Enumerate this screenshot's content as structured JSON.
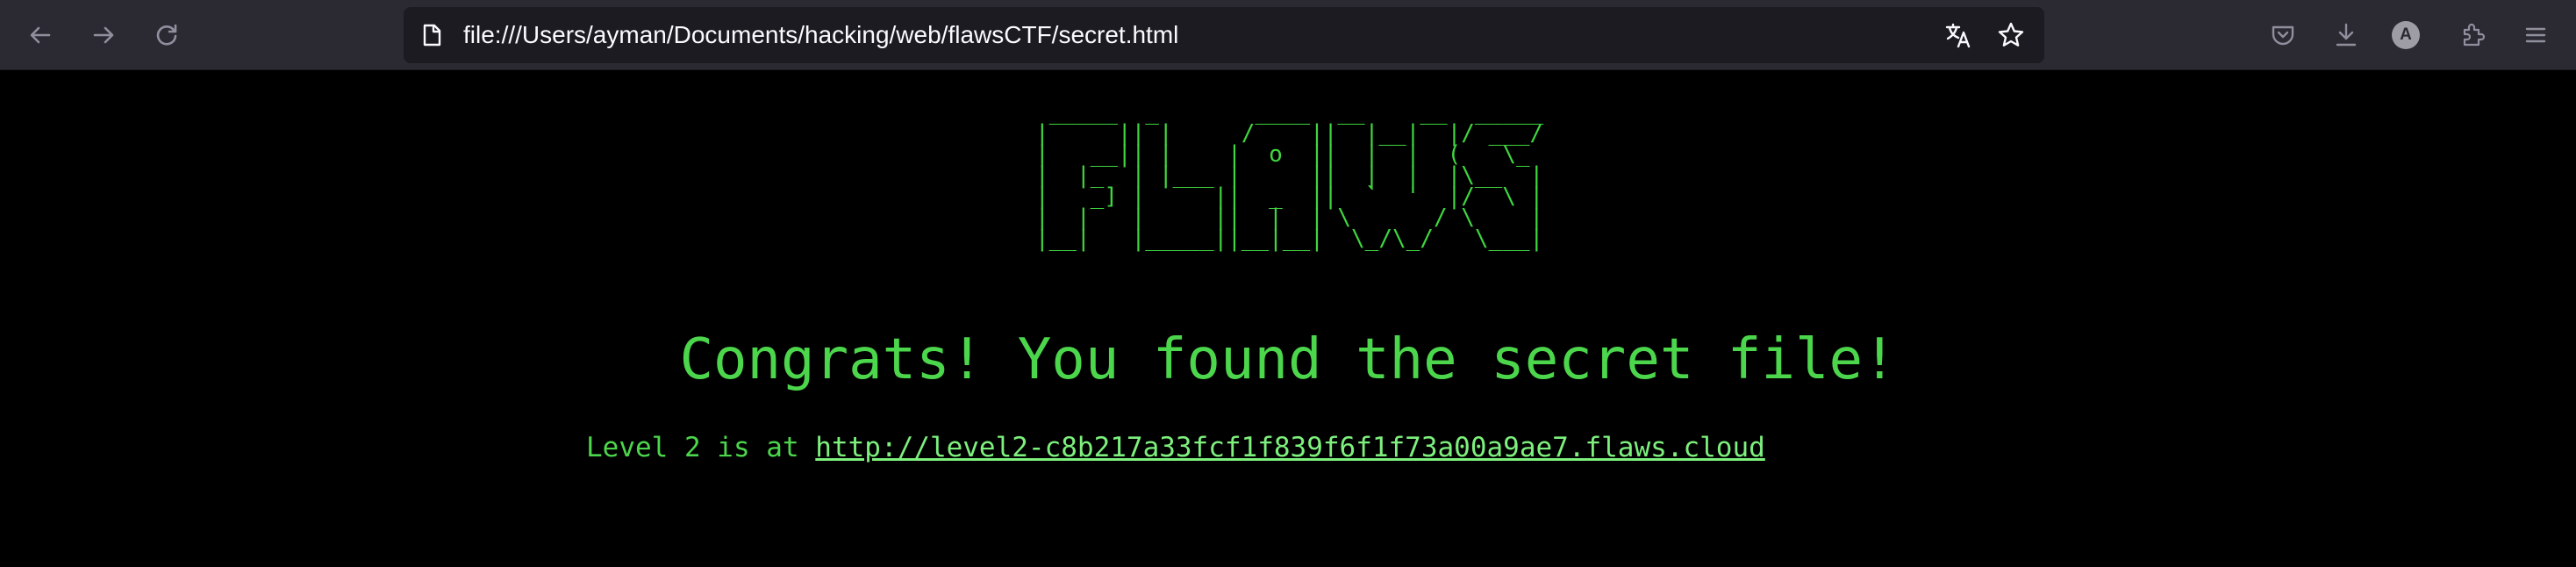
{
  "browser": {
    "url": "file:///Users/ayman/Documents/hacking/web/flawsCTF/secret.html",
    "profile_initial": "A",
    "icons": {
      "back": "arrow-left-icon",
      "forward": "arrow-right-icon",
      "reload": "reload-icon",
      "page": "page-icon",
      "translate": "translate-icon",
      "bookmark": "star-icon",
      "pocket": "pocket-icon",
      "downloads": "download-icon",
      "account": "account-icon",
      "extensions": "puzzle-icon",
      "menu": "hamburger-menu-icon"
    }
  },
  "page": {
    "ascii_art": " _____  _       ____  __    __  _____\n|     || |     /    ||  |__|  |/ ___/\n|   __|| |    |  o  ||  |  |  (   \\_\n|  |_  | |___ |     ||  |  |  |\\__  |\n|   _] |     ||  _  ||  `  '  |/  \\ |\n|  |   |     ||  |  | \\      / \\    |\n|__|   |_____||__|__|  \\_/\\_/   \\___|",
    "congrats": "Congrats! You found the secret file!",
    "level_prefix": "Level 2 is at ",
    "level_link": "http://level2-c8b217a33fcf1f839f6f1f73a00a9ae7.flaws.cloud"
  },
  "colors": {
    "toolbar_bg": "#2b2a33",
    "urlbar_bg": "#1c1b22",
    "page_bg": "#000000",
    "terminal_green": "#4cd64c",
    "link_green": "#7df07d"
  }
}
